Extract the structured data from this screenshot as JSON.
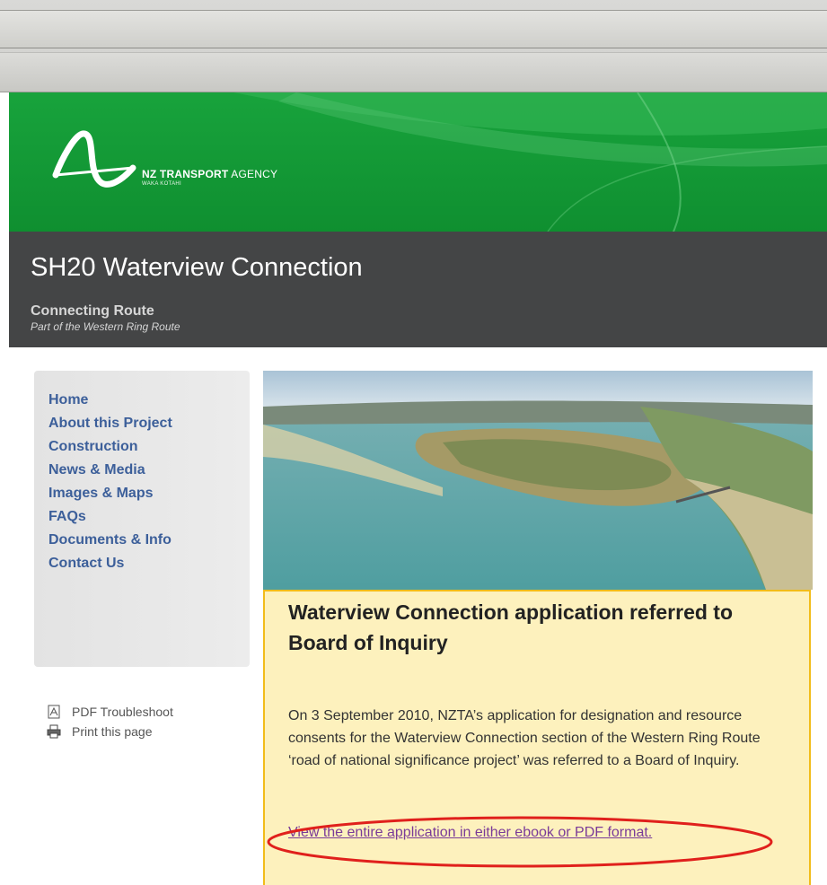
{
  "logo": {
    "agency_bold": "NZ TRANSPORT",
    "agency_rest": "AGENCY",
    "sub": "WAKA KOTAHI"
  },
  "site": {
    "title": "SH20 Waterview Connection",
    "subtitle": "Connecting Route",
    "tagline": "Part of the Western Ring Route"
  },
  "nav": {
    "items": [
      {
        "label": "Home"
      },
      {
        "label": "About this Project"
      },
      {
        "label": "Construction"
      },
      {
        "label": "News & Media"
      },
      {
        "label": "Images & Maps"
      },
      {
        "label": "FAQs"
      },
      {
        "label": "Documents & Info"
      },
      {
        "label": "Contact Us"
      }
    ]
  },
  "tools": {
    "pdf": "PDF Troubleshoot",
    "print": "Print this page"
  },
  "notice": {
    "heading": "Waterview Connection application referred to Board of Inquiry",
    "body": "On 3 September 2010, NZTA’s application for designation and resource consents for the Waterview Connection section of the Western Ring Route ‘road of national significance project’ was referred to a Board of Inquiry.",
    "link": "View the entire application in either ebook or PDF format."
  },
  "colors": {
    "header_green": "#18a33c",
    "title_band": "#444546",
    "nav_link": "#3c5f9a",
    "notice_bg": "#fdf1bd",
    "notice_border": "#f2bc1a",
    "highlight_ring": "#e0201c"
  }
}
